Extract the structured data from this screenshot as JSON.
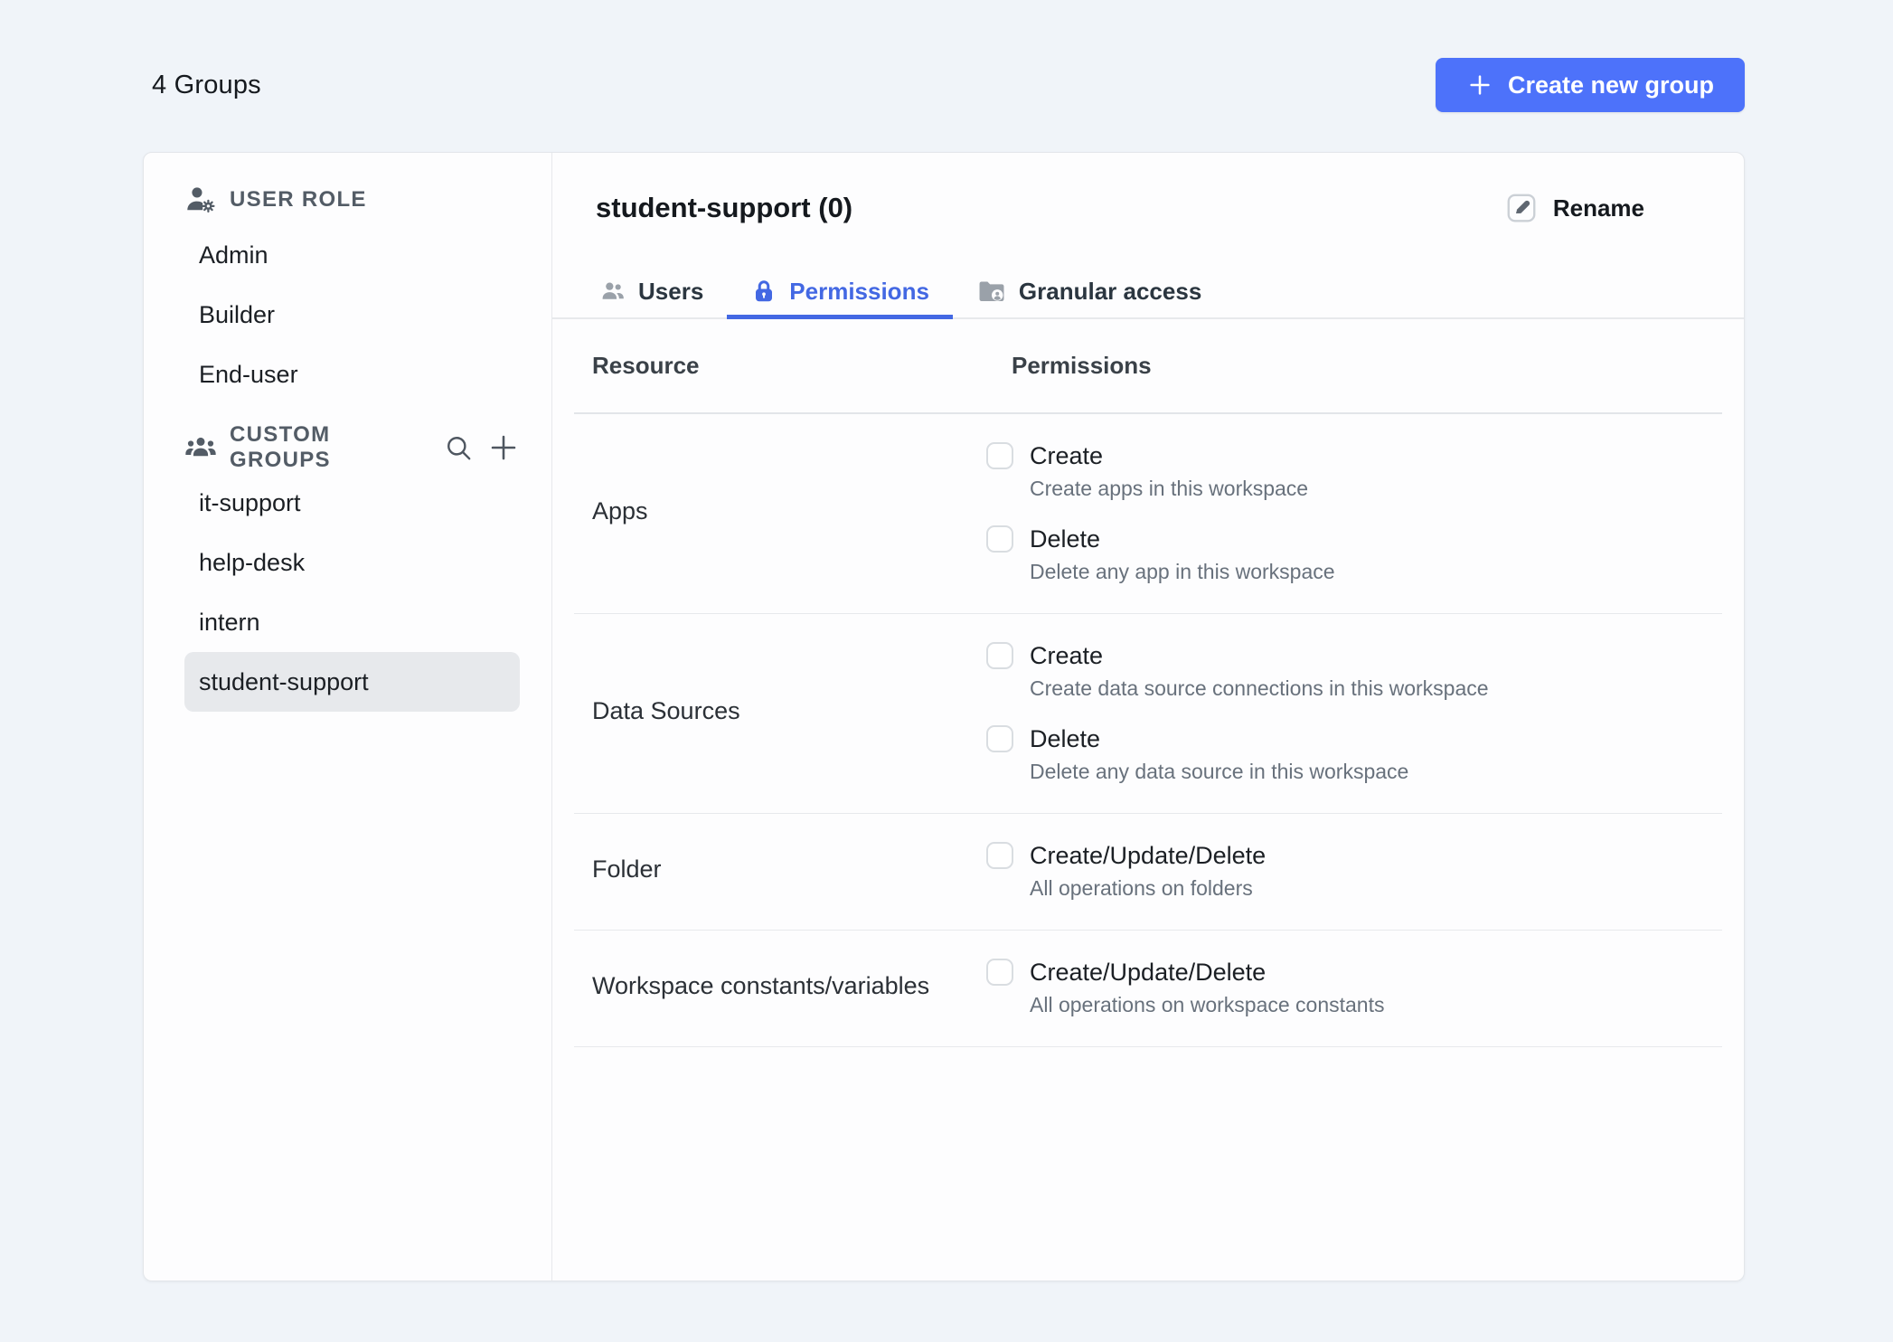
{
  "page": {
    "heading": "4 Groups",
    "create_button_label": "Create new group"
  },
  "colors": {
    "primary_button": "#4D72FA",
    "active_tab": "#4368E3",
    "background": "#F0F4F9",
    "selected_item_bg": "#E7E9EC"
  },
  "sidebar": {
    "user_role": {
      "title": "USER ROLE",
      "icon": "person-gear-icon",
      "items": [
        {
          "label": "Admin",
          "selected": false
        },
        {
          "label": "Builder",
          "selected": false
        },
        {
          "label": "End-user",
          "selected": false
        }
      ]
    },
    "custom_groups": {
      "title": "CUSTOM GROUPS",
      "icon": "users-icon",
      "actions": [
        "search-icon",
        "add-group-icon"
      ],
      "items": [
        {
          "label": "it-support",
          "selected": false
        },
        {
          "label": "help-desk",
          "selected": false
        },
        {
          "label": "intern",
          "selected": false
        },
        {
          "label": "student-support",
          "selected": true
        }
      ]
    }
  },
  "content": {
    "title": "student-support (0)",
    "rename_button_label": "Rename",
    "tabs": [
      {
        "label": "Users",
        "icon": "users-icon",
        "active": false
      },
      {
        "label": "Permissions",
        "icon": "lock-icon",
        "active": true
      },
      {
        "label": "Granular access",
        "icon": "folder-user-icon",
        "active": false
      }
    ],
    "table": {
      "columns": {
        "resource": "Resource",
        "permissions": "Permissions"
      },
      "rows": [
        {
          "resource": "Apps",
          "permissions": [
            {
              "label": "Create",
              "description": "Create apps in this workspace",
              "checked": false
            },
            {
              "label": "Delete",
              "description": "Delete any app in this workspace",
              "checked": false
            }
          ]
        },
        {
          "resource": "Data Sources",
          "permissions": [
            {
              "label": "Create",
              "description": "Create data source connections in this workspace",
              "checked": false
            },
            {
              "label": "Delete",
              "description": "Delete any data source in this workspace",
              "checked": false
            }
          ]
        },
        {
          "resource": "Folder",
          "permissions": [
            {
              "label": "Create/Update/Delete",
              "description": "All operations on folders",
              "checked": false
            }
          ]
        },
        {
          "resource": "Workspace constants/variables",
          "permissions": [
            {
              "label": "Create/Update/Delete",
              "description": "All operations on workspace constants",
              "checked": false
            }
          ]
        }
      ]
    }
  }
}
